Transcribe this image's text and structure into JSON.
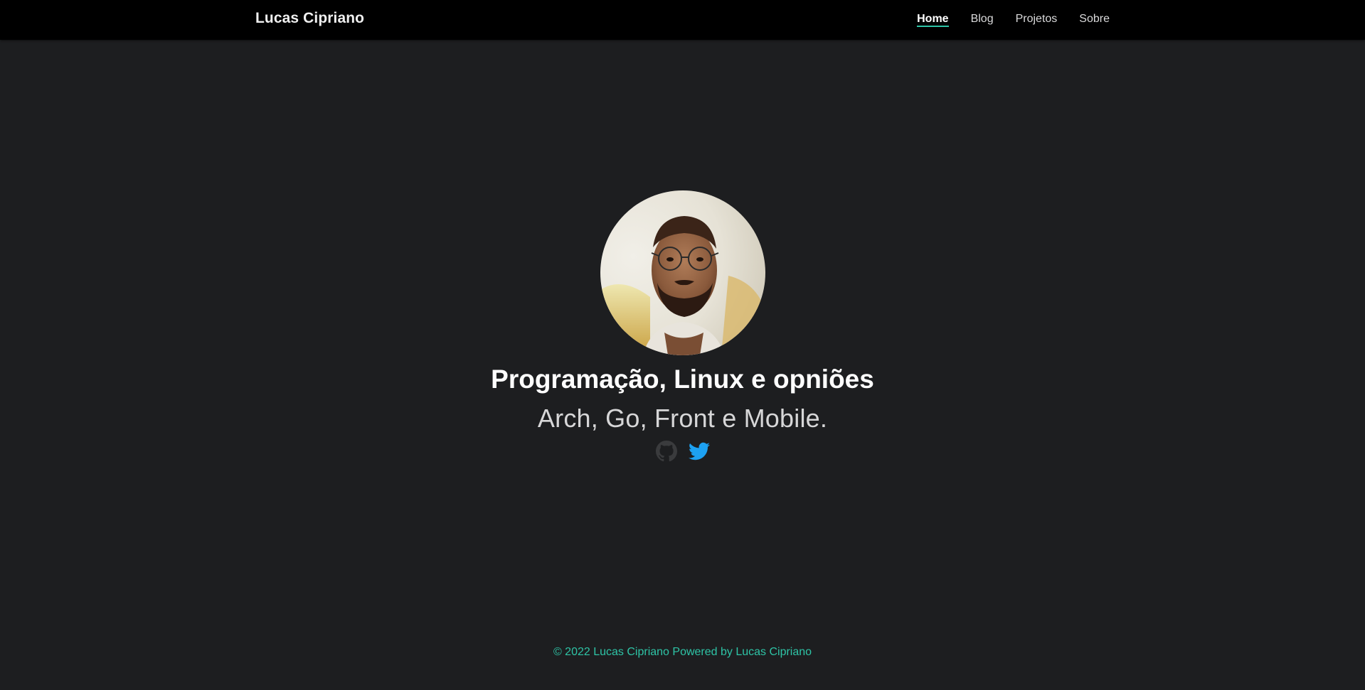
{
  "header": {
    "brand": "Lucas Cipriano",
    "nav": [
      {
        "label": "Home",
        "active": true
      },
      {
        "label": "Blog",
        "active": false
      },
      {
        "label": "Projetos",
        "active": false
      },
      {
        "label": "Sobre",
        "active": false
      }
    ]
  },
  "hero": {
    "title": "Programação, Linux e opniões",
    "subtitle": "Arch, Go, Front e Mobile.",
    "social": [
      {
        "icon": "github-icon"
      },
      {
        "icon": "twitter-icon"
      }
    ]
  },
  "footer": {
    "copyright": "© 2022 Lucas Cipriano",
    "powered_by": "Powered by Lucas Cipriano"
  },
  "colors": {
    "background": "#1d1e20",
    "navbar": "#000000",
    "accent": "#2ec4a6",
    "twitter": "#1da1f2",
    "github": "#3a3b3d"
  }
}
